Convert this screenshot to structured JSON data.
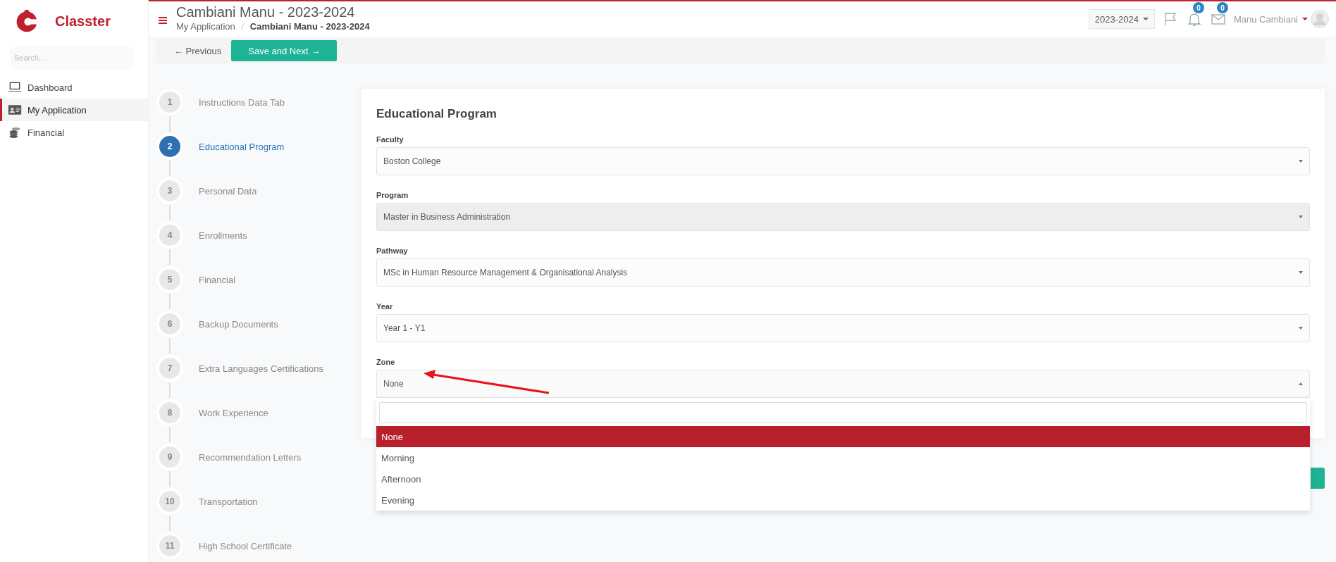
{
  "sidebar": {
    "brand": "Classter",
    "search": {
      "placeholder": "Search..."
    },
    "items": [
      {
        "label": "Dashboard",
        "kind": "laptop",
        "selected": false
      },
      {
        "label": "My Application",
        "kind": "idcard",
        "selected": true
      },
      {
        "label": "Financial",
        "kind": "coins",
        "selected": false
      }
    ]
  },
  "header": {
    "title": "Cambiani Manu - 2023-2024",
    "breadcrumb": [
      "My Application",
      "Cambiani Manu - 2023-2024"
    ],
    "year_selector": "2023-2024",
    "notifications_count": "0",
    "messages_count": "0",
    "user_name": "Manu Cambiani"
  },
  "toolbar": {
    "previous": "← Previous",
    "save_next": "Save and Next →"
  },
  "steps": [
    {
      "number": "1",
      "label": "Instructions Data Tab",
      "selected": false
    },
    {
      "number": "2",
      "label": "Educational Program",
      "selected": true
    },
    {
      "number": "3",
      "label": "Personal Data",
      "selected": false
    },
    {
      "number": "4",
      "label": "Enrollments",
      "selected": false
    },
    {
      "number": "5",
      "label": "Financial",
      "selected": false
    },
    {
      "number": "6",
      "label": "Backup Documents",
      "selected": false
    },
    {
      "number": "7",
      "label": "Extra Languages Certifications",
      "selected": false
    },
    {
      "number": "8",
      "label": "Work Experience",
      "selected": false
    },
    {
      "number": "9",
      "label": "Recommendation Letters",
      "selected": false
    },
    {
      "number": "10",
      "label": "Transportation",
      "selected": false
    },
    {
      "number": "11",
      "label": "High School Certificate",
      "selected": false
    }
  ],
  "form": {
    "title": "Educational Program",
    "fields": [
      {
        "label": "Faculty",
        "value": "Boston College",
        "disabled": false,
        "expanded": false
      },
      {
        "label": "Program",
        "value": "Master in Business Administration",
        "disabled": true,
        "expanded": false
      },
      {
        "label": "Pathway",
        "value": "MSc in Human Resource Management & Organisational Analysis",
        "disabled": false,
        "expanded": false
      },
      {
        "label": "Year",
        "value": "Year 1 - Y1",
        "disabled": false,
        "expanded": false
      },
      {
        "label": "Zone",
        "value": "None",
        "disabled": false,
        "expanded": true
      }
    ],
    "dropdown_options": [
      {
        "label": "None",
        "selected": true
      },
      {
        "label": "Morning",
        "selected": false
      },
      {
        "label": "Afternoon",
        "selected": false
      },
      {
        "label": "Evening",
        "selected": false
      }
    ]
  }
}
